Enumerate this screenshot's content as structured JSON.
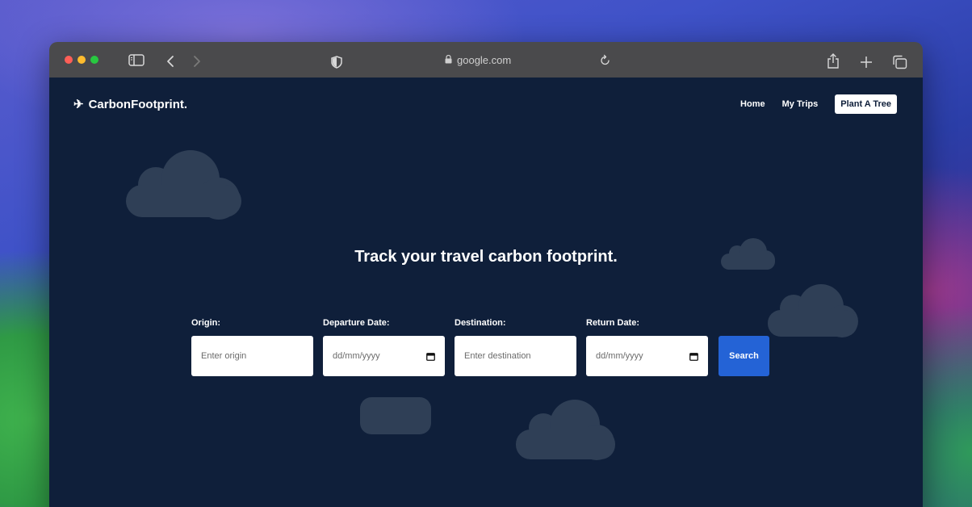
{
  "browser": {
    "url": "google.com",
    "icons": [
      "sidebar-icon",
      "back-icon",
      "forward-icon",
      "shield-icon",
      "lock-icon",
      "reload-icon",
      "share-icon",
      "new-tab-icon",
      "tabs-overview-icon"
    ]
  },
  "site": {
    "logo_icon": "✈",
    "logo_text": "CarbonFootprint.",
    "nav": {
      "home": "Home",
      "my_trips": "My Trips",
      "plant_tree": "Plant A Tree"
    },
    "headline": "Track your travel carbon footprint.",
    "form": {
      "origin": {
        "label": "Origin:",
        "placeholder": "Enter origin"
      },
      "departure": {
        "label": "Departure Date:",
        "placeholder": "dd/mm/yyyy"
      },
      "destination": {
        "label": "Destination:",
        "placeholder": "Enter destination"
      },
      "return": {
        "label": "Return Date:",
        "placeholder": "dd/mm/yyyy"
      },
      "search_label": "Search"
    }
  },
  "colors": {
    "page_bg": "#0f1f3a",
    "cloud": "#2f3f56",
    "accent": "#2463d6",
    "toolbar": "#4a4a4c"
  }
}
